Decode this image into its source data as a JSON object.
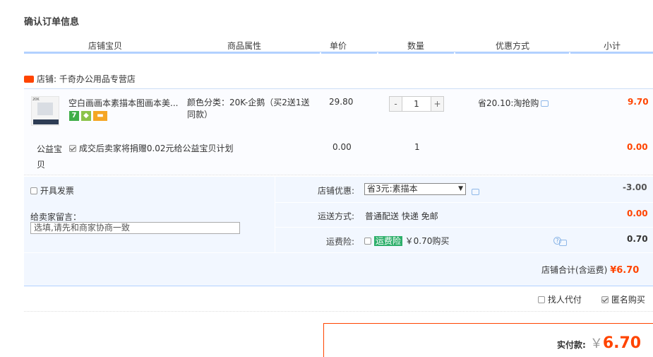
{
  "page_title": "确认订单信息",
  "columns": [
    "店铺宝贝",
    "商品属性",
    "单价",
    "数量",
    "优惠方式",
    "小计"
  ],
  "shop": {
    "label": "店铺:",
    "name": "千奇办公用品专营店"
  },
  "item": {
    "thumb_text": "20K",
    "name": "空白画画本素描本图画本美...",
    "attributes": "颜色分类：20K-企鹅（买2送1送同款）",
    "price": "29.80",
    "qty_minus": "-",
    "quantity": "1",
    "qty_plus": "+",
    "discount": "省20.10:淘抢购",
    "subtotal": "9.70",
    "icons": [
      "seven-day-return-icon",
      "shield-icon",
      "card-icon"
    ]
  },
  "charity": {
    "label": "公益宝贝",
    "text": "成交后卖家将捐赠0.02元给公益宝贝计划",
    "price": "0.00",
    "quantity": "1",
    "subtotal": "0.00",
    "checked": true
  },
  "invoice": {
    "label": "开具发票",
    "checked": false
  },
  "message": {
    "label": "给卖家留言：",
    "placeholder": "选填,请先和商家协商一致"
  },
  "shop_discount": {
    "label": "店铺优惠:",
    "selected": "省3元:素描本",
    "amount": "-3.00"
  },
  "shipping": {
    "label": "运送方式:",
    "value": "普通配送 快递 免邮",
    "amount": "0.00"
  },
  "insurance": {
    "label": "运费险:",
    "tag": "运费险",
    "price": "￥0.70购买",
    "amount": "0.70",
    "checked": false
  },
  "shop_total": {
    "label": "店铺合计(含运费)",
    "value": "¥6.70"
  },
  "options": {
    "proxy_pay": "找人代付",
    "proxy_checked": false,
    "anonymous": "匿名购买",
    "anonymous_checked": true
  },
  "pay": {
    "label": "实付款:",
    "currency": "￥",
    "amount": "6.70"
  },
  "colors": {
    "accent": "#ff4400",
    "header_line": "#b2d1ff",
    "panel_bg": "#f2f7ff"
  }
}
